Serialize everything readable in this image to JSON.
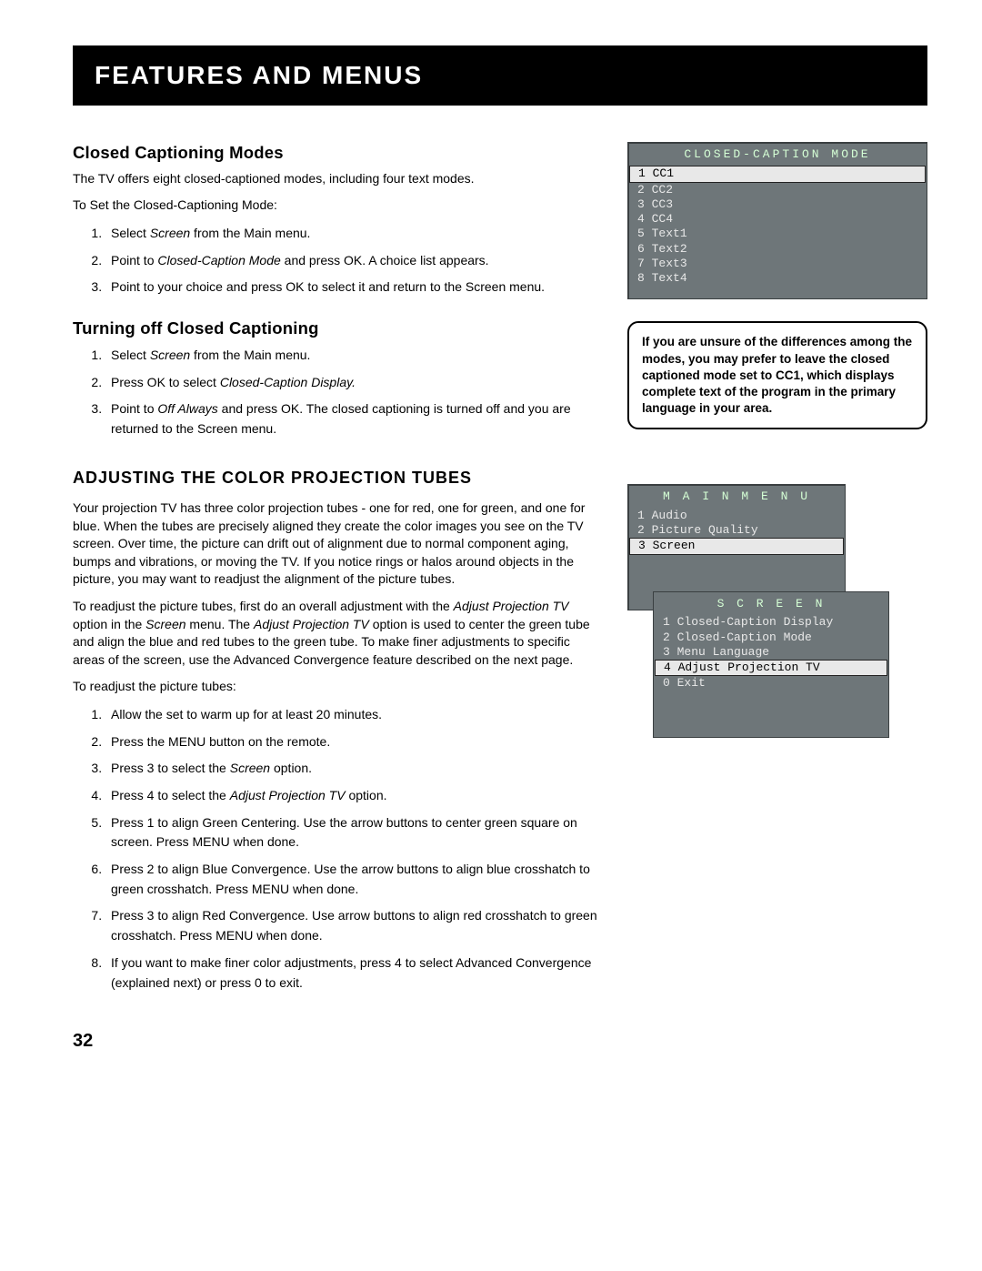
{
  "header": "Features and Menus",
  "section1": {
    "title": "Closed Captioning Modes",
    "intro": "The TV offers eight closed-captioned modes, including four text modes.",
    "lead": "To Set the Closed-Captioning Mode:",
    "steps": [
      "Select Screen from the Main menu.",
      "Point to Closed-Caption Mode and press OK.  A choice list appears.",
      "Point to your choice and press OK to select it and return to the Screen menu."
    ]
  },
  "section2": {
    "title": "Turning off Closed Captioning",
    "steps": [
      "Select Screen from the Main menu.",
      "Press OK to select Closed-Caption Display.",
      "Point to Off Always and press OK. The closed captioning is turned off and you are returned to the Screen menu."
    ]
  },
  "section3": {
    "title": "Adjusting the Color Projection Tubes",
    "para1": "Your projection TV has three color projection tubes - one for red, one for green, and one for blue. When the tubes are precisely aligned they create the color images you see on the TV screen. Over time, the picture can drift out of alignment due to normal component aging, bumps and vibrations, or moving the TV. If you notice rings or halos around objects in the picture, you may want to readjust the alignment of the picture tubes.",
    "para2": "To readjust the picture tubes, first do an overall adjustment with the Adjust Projection TV option in the Screen menu. The Adjust Projection TV option is used to center the green tube and align the blue and red tubes to the green tube. To make finer adjustments to specific areas of the screen, use the Advanced Convergence feature described on the next page.",
    "lead": "To readjust the picture tubes:",
    "steps": [
      "Allow the set to warm up for at least 20 minutes.",
      "Press the MENU button on the remote.",
      "Press 3 to select the Screen option.",
      "Press 4 to select the Adjust Projection TV option.",
      "Press 1 to align Green Centering.  Use the arrow buttons to center green square on screen.  Press MENU when done.",
      "Press 2 to align Blue Convergence.  Use the arrow buttons to align blue crosshatch to green crosshatch.  Press MENU when done.",
      "Press 3 to align Red Convergence.  Use arrow buttons to align red crosshatch to green crosshatch.  Press MENU when done.",
      "If you want to make finer color adjustments, press 4 to select Advanced Convergence (explained next) or press 0 to exit."
    ]
  },
  "osd1": {
    "title": "CLOSED-CAPTION MODE",
    "items": [
      {
        "n": "1",
        "label": "CC1",
        "selected": true
      },
      {
        "n": "2",
        "label": "CC2"
      },
      {
        "n": "3",
        "label": "CC3"
      },
      {
        "n": "4",
        "label": "CC4"
      },
      {
        "n": "5",
        "label": "Text1"
      },
      {
        "n": "6",
        "label": "Text2"
      },
      {
        "n": "7",
        "label": "Text3"
      },
      {
        "n": "8",
        "label": "Text4"
      }
    ]
  },
  "tip": "If you are unsure of the differences among the modes, you may prefer to leave the closed captioned mode set to CC1, which displays complete text of the program in the primary language in your area.",
  "osd2": {
    "title": "M A I N   M E N U",
    "items": [
      {
        "n": "1",
        "label": "Audio"
      },
      {
        "n": "2",
        "label": "Picture Quality"
      },
      {
        "n": "3",
        "label": "Screen",
        "selected": true
      }
    ],
    "submenu_title": "S C R E E N",
    "sub_items": [
      {
        "n": "1",
        "label": "Closed-Caption Display"
      },
      {
        "n": "2",
        "label": "Closed-Caption Mode"
      },
      {
        "n": "3",
        "label": "Menu Language"
      },
      {
        "n": "4",
        "label": "Adjust Projection TV",
        "selected": true
      },
      {
        "n": "0",
        "label": "Exit"
      }
    ]
  },
  "page_number": "32"
}
